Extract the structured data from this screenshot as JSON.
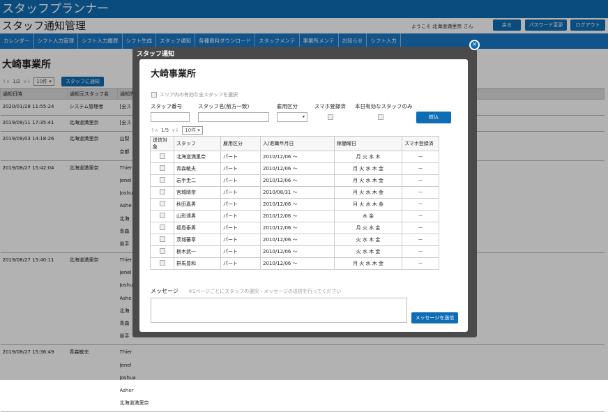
{
  "app_title": "スタッフプランナー",
  "page_title": "スタッフ通知管理",
  "welcome": "ようこそ 北海道満里奈 さん",
  "header_buttons": [
    "戻る",
    "パスワード変更",
    "ログアウト"
  ],
  "nav": [
    "カレンダー",
    "シフト入力管理",
    "シフト入力履歴",
    "シフト生成",
    "スタッフ通知",
    "各種資料ダウンロード",
    "スタッフメンテ",
    "事業所メンテ",
    "お知らせ",
    "シフト入力"
  ],
  "office": "大崎事業所",
  "pager": {
    "page": "1/2",
    "per_page": "10件",
    "notify_button": "スタッフに通知"
  },
  "bg_table": {
    "headers": [
      "通知日時",
      "通知元スタッフ名",
      "通知先"
    ],
    "rows": [
      {
        "date": "2020/01/28 11:55:24",
        "from": "システム管理者",
        "to": [
          "[全ス"
        ]
      },
      {
        "date": "2019/09/11 17:35:41",
        "from": "北海道満里奈",
        "to": [
          "[全ス"
        ]
      },
      {
        "date": "2019/09/03 14:18:26",
        "from": "北海道満里奈",
        "to": [
          "山梨",
          "京都"
        ]
      },
      {
        "date": "2019/08/27 15:42:04",
        "from": "北海道満里奈",
        "to": [
          "Thier",
          "Jenel",
          "Joshu",
          "Ashe",
          "北海",
          "青森",
          "岩手"
        ]
      },
      {
        "date": "2019/08/27 15:40:11",
        "from": "北海道満里奈",
        "to": [
          "Thier",
          "Jenel",
          "Joshu",
          "Ashe",
          "北海",
          "青森",
          "岩手"
        ]
      },
      {
        "date": "2019/08/27 15:36:49",
        "from": "青森敏夫",
        "to": [
          "Thier",
          "Jenel",
          "Joshua",
          "Asher",
          "北海道満里奈"
        ]
      }
    ]
  },
  "modal": {
    "title": "スタッフ通知",
    "office": "大崎事業所",
    "area_checkbox": "エリア内の有効な全スタッフを選択",
    "filters": {
      "staff_no": "スタッフ番号",
      "staff_name": "スタッフ名(前方一致)",
      "employment": "雇用区分",
      "smartphone": "スマホ登録済",
      "valid_only": "本日有効なスタッフのみ",
      "search_button": "絞込"
    },
    "pager": {
      "page": "1/5",
      "per_page": "10件"
    },
    "table": {
      "headers": [
        "送信対象",
        "スタッフ",
        "雇用区分",
        "入/退職年月日",
        "稼働曜日",
        "スマホ登録済"
      ],
      "rows": [
        {
          "name": "北海道満里奈",
          "type": "パート",
          "date": "2010/12/06 ～",
          "days": "月 火 水 木",
          "phone": "－"
        },
        {
          "name": "青森敏夫",
          "type": "パート",
          "date": "2010/12/06 ～",
          "days": "月 火 水 木 金",
          "phone": "－"
        },
        {
          "name": "岩手圭二",
          "type": "パート",
          "date": "2010/12/06 ～",
          "days": "月 火 水 木 金",
          "phone": "－"
        },
        {
          "name": "宮城晴奈",
          "type": "パート",
          "date": "2010/08/31 ～",
          "days": "月 火 水 木 金",
          "phone": "－"
        },
        {
          "name": "秋田嘉男",
          "type": "パート",
          "date": "2010/12/06 ～",
          "days": "月 火 水 木 金",
          "phone": "－"
        },
        {
          "name": "山形達男",
          "type": "パート",
          "date": "2010/12/06 ～",
          "days": "木 金",
          "phone": "－"
        },
        {
          "name": "福島泰男",
          "type": "パート",
          "date": "2010/12/06 ～",
          "days": "月 火 水 金",
          "phone": "－"
        },
        {
          "name": "茨城蕃章",
          "type": "パート",
          "date": "2010/12/06 ～",
          "days": "火 水 木 金",
          "phone": "－"
        },
        {
          "name": "栃木武一",
          "type": "パート",
          "date": "2010/12/06 ～",
          "days": "火 水 木 金",
          "phone": "－"
        },
        {
          "name": "群馬豊和",
          "type": "パート",
          "date": "2010/12/06 ～",
          "days": "月 火 水 木 金",
          "phone": "－"
        }
      ]
    },
    "message_label": "メッセージ",
    "message_note": "※1ページごとにスタッフの選択・メッセージの送信を行ってください",
    "send_button": "メッセージを送信",
    "close_icon": "×"
  }
}
